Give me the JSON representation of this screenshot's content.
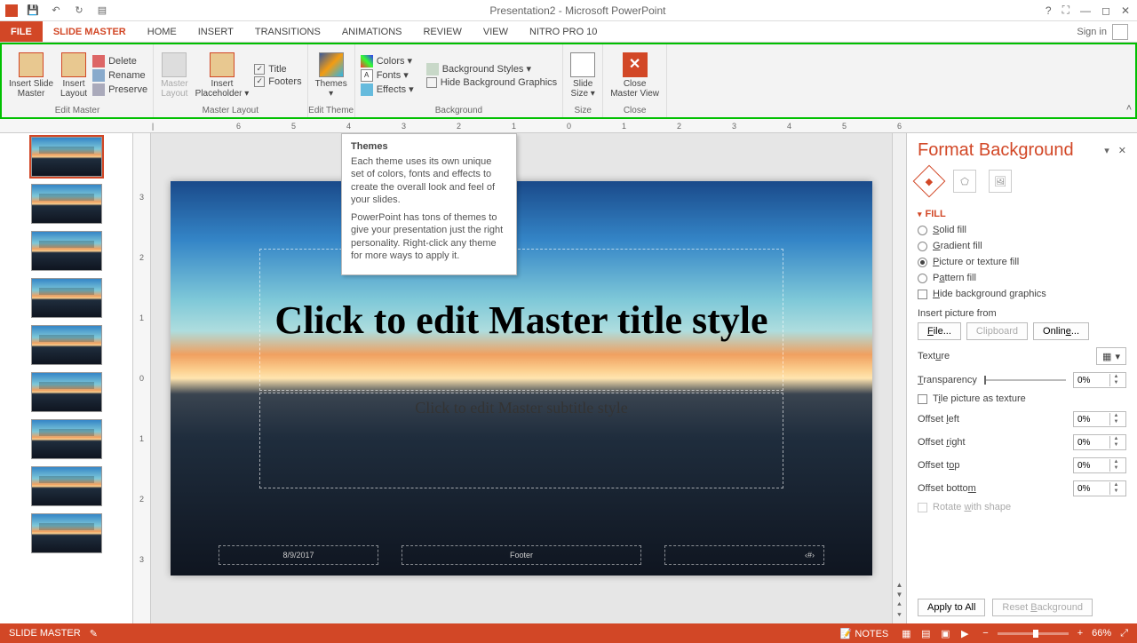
{
  "title": "Presentation2 - Microsoft PowerPoint",
  "signin": "Sign in",
  "tabs": {
    "file": "FILE",
    "slide_master": "SLIDE MASTER",
    "home": "HOME",
    "insert": "INSERT",
    "transitions": "TRANSITIONS",
    "animations": "ANIMATIONS",
    "review": "REVIEW",
    "view": "VIEW",
    "nitro": "NITRO PRO 10"
  },
  "ribbon": {
    "insert_slide_master": "Insert Slide\nMaster",
    "insert_layout": "Insert\nLayout",
    "delete": "Delete",
    "rename": "Rename",
    "preserve": "Preserve",
    "edit_master_group": "Edit Master",
    "master_layout": "Master\nLayout",
    "insert_placeholder": "Insert\nPlaceholder ▾",
    "title_chk": "Title",
    "footers_chk": "Footers",
    "master_layout_group": "Master Layout",
    "themes": "Themes\n▾",
    "edit_theme_group": "Edit Theme",
    "colors": "Colors ▾",
    "fonts": "Fonts ▾",
    "effects": "Effects ▾",
    "bg_styles": "Background Styles ▾",
    "hide_bg": "Hide Background Graphics",
    "background_group": "Background",
    "slide_size": "Slide\nSize ▾",
    "size_group": "Size",
    "close_master": "Close\nMaster View",
    "close_group": "Close"
  },
  "tooltip": {
    "title": "Themes",
    "p1": "Each theme uses its own unique set of colors, fonts and effects to create the overall look and feel of your slides.",
    "p2": "PowerPoint has tons of themes to give your presentation just the right personality. Right-click any theme for more ways to apply it."
  },
  "slide": {
    "title": "Click to edit Master title style",
    "subtitle": "Click to edit Master subtitle style",
    "date": "8/9/2017",
    "footer": "Footer"
  },
  "pane": {
    "title": "Format Background",
    "fill": "FILL",
    "solid": "Solid fill",
    "gradient": "Gradient fill",
    "picture": "Picture or texture fill",
    "pattern": "Pattern fill",
    "hide_bg": "Hide background graphics",
    "insert_from": "Insert picture from",
    "file_btn": "File...",
    "clipboard_btn": "Clipboard",
    "online_btn": "Online...",
    "texture": "Texture",
    "transparency": "Transparency",
    "transparency_val": "0%",
    "tile": "Tile picture as texture",
    "offset_left": "Offset left",
    "offset_right": "Offset right",
    "offset_top": "Offset top",
    "offset_bottom": "Offset bottom",
    "offset_val": "0%",
    "rotate": "Rotate with shape",
    "apply_all": "Apply to All",
    "reset": "Reset Background"
  },
  "status": {
    "mode": "SLIDE MASTER",
    "notes": "NOTES",
    "zoom": "66%"
  },
  "ruler_h": [
    "6",
    "5",
    "4",
    "3",
    "2",
    "1",
    "0",
    "1",
    "2",
    "3",
    "4",
    "5",
    "6"
  ],
  "ruler_v": [
    "3",
    "2",
    "1",
    "0",
    "1",
    "2",
    "3"
  ]
}
